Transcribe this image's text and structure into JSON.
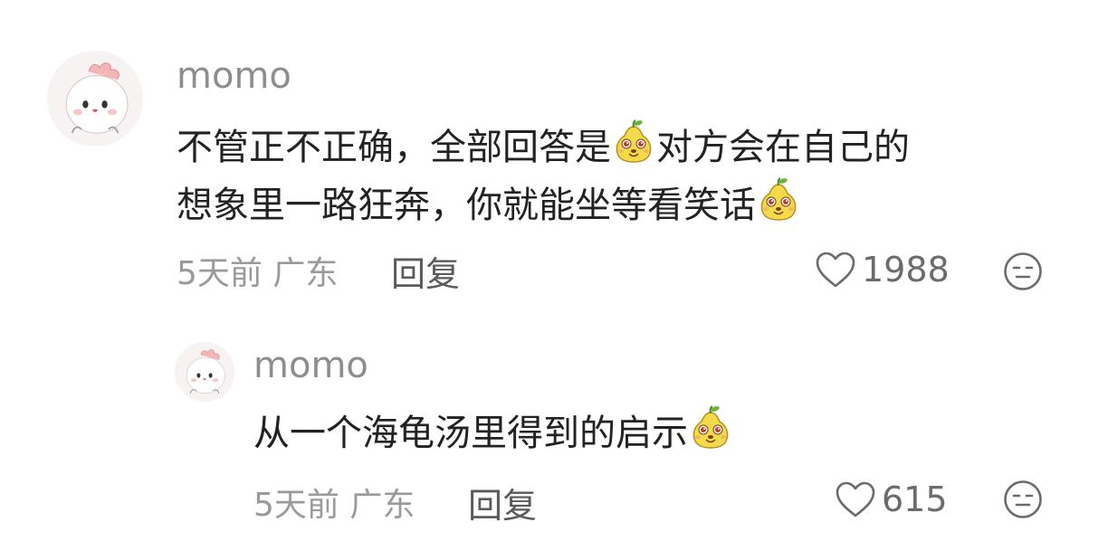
{
  "comment": {
    "username": "momo",
    "line1_a": "不管正不正确，全部回答是",
    "line1_b": "对方会在自己的",
    "line2": "想象里一路狂奔，你就能坐等看笑话",
    "time": "5天前",
    "location": "广东",
    "reply_label": "回复",
    "likes": "1988",
    "emoji_icon": "pear-face-emoji",
    "avatar_icon": "cute-chicken-avatar"
  },
  "reply": {
    "username": "momo",
    "text": "从一个海龟汤里得到的启示",
    "time": "5天前",
    "location": "广东",
    "reply_label": "回复",
    "likes": "615"
  },
  "colors": {
    "username": "#8d8d8d",
    "text": "#222222",
    "meta": "#9a9a9a",
    "reply": "#5a5a5a"
  }
}
